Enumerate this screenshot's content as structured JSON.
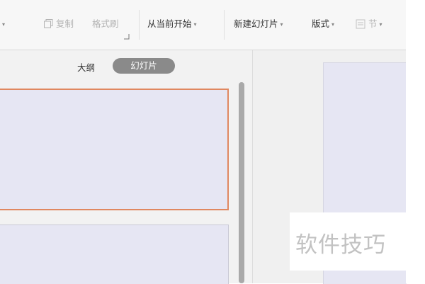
{
  "toolbar": {
    "partial_caret": "▾",
    "copy_label": "复制",
    "format_painter_label": "格式刷",
    "from_current_label": "从当前开始",
    "new_slide_label": "新建幻灯片",
    "layout_label": "版式",
    "section_label": "节",
    "caret": "▾"
  },
  "panel": {
    "tab_outline": "大纲",
    "tab_slides": "幻灯片"
  },
  "watermark": {
    "text": "软件技巧"
  },
  "colors": {
    "selected_border": "#e08860",
    "slide_fill": "#e6e6f3",
    "tab_active_bg": "#8a8a8a"
  },
  "icons": [
    "copy-icon",
    "dialog-launcher-icon",
    "section-icon",
    "dropdown-caret-icon"
  ]
}
